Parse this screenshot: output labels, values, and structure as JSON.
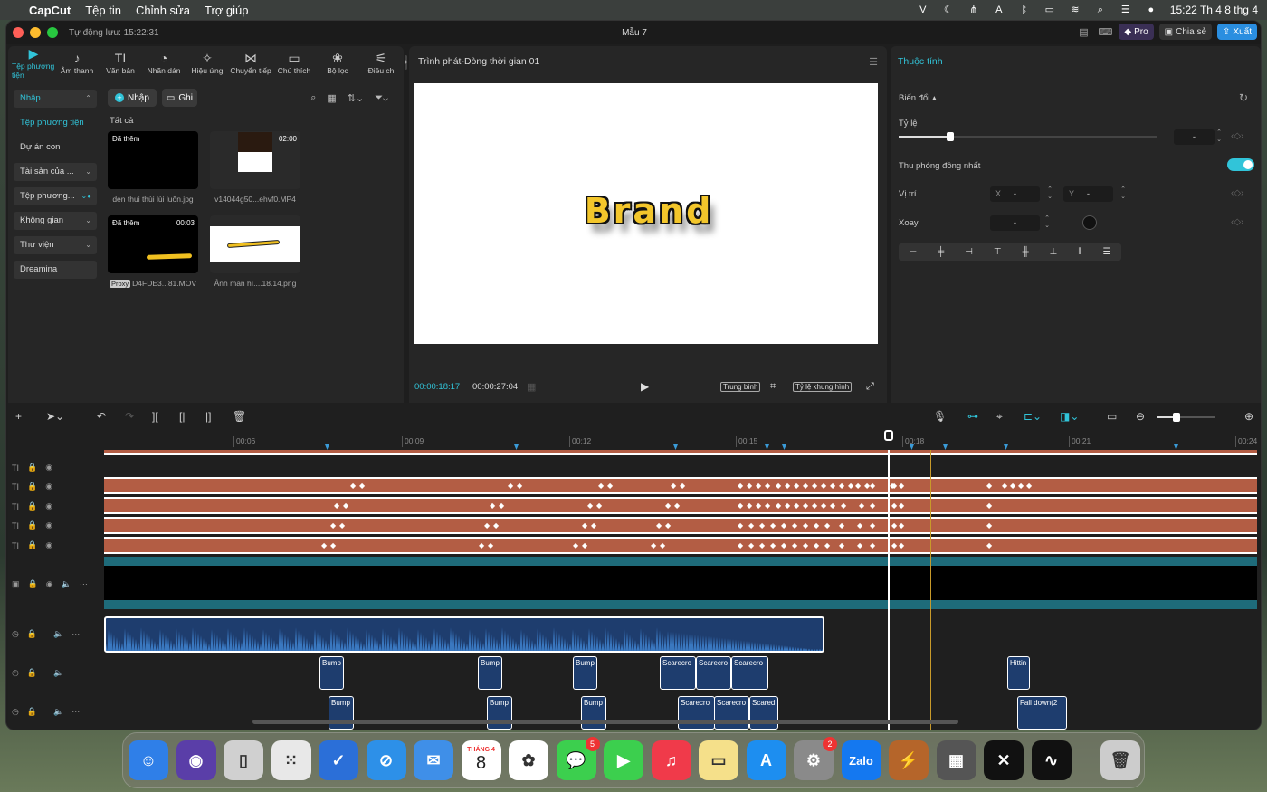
{
  "menubar": {
    "app": "CapCut",
    "items": [
      "Tệp tin",
      "Chỉnh sửa",
      "Trợ giúp"
    ],
    "clock": "15:22 Th 4 8 thg 4"
  },
  "window": {
    "autosave": "Tự động lưu: 15:22:31",
    "title": "Mẫu 7",
    "pro": "Pro",
    "share": "Chia sẻ",
    "export": "Xuất"
  },
  "tooltabs": [
    {
      "label": "Tệp phương tiện",
      "icon": "▶"
    },
    {
      "label": "Âm thanh",
      "icon": "♪"
    },
    {
      "label": "Văn bản",
      "icon": "TI"
    },
    {
      "label": "Nhãn dán",
      "icon": "◔"
    },
    {
      "label": "Hiệu ứng",
      "icon": "✧"
    },
    {
      "label": "Chuyển tiếp",
      "icon": "⋈"
    },
    {
      "label": "Chú thích",
      "icon": "▭"
    },
    {
      "label": "Bộ lọc",
      "icon": "❀"
    },
    {
      "label": "Điều ch",
      "icon": "⚟"
    }
  ],
  "sidebar": {
    "import": "Nhập",
    "media": "Tệp phương tiện",
    "subproject": "Dự án con",
    "assets": "Tài sản của ...",
    "media2": "Tệp phương...",
    "space": "Không gian",
    "library": "Thư viện",
    "dreamina": "Dreamina"
  },
  "media": {
    "import_btn": "Nhập",
    "record_btn": "Ghi",
    "filter": "Tất cả",
    "items": [
      {
        "tag": "Đã thêm",
        "duration": "",
        "name": "den thui thùi lùi luôn.jpg",
        "proxy": ""
      },
      {
        "tag": "",
        "duration": "02:00",
        "name": "v14044g50...ehvf0.MP4",
        "proxy": ""
      },
      {
        "tag": "Đã thêm",
        "duration": "00:03",
        "name": "D4FDE3...81.MOV",
        "proxy": "Proxy"
      },
      {
        "tag": "",
        "duration": "",
        "name": "Ảnh màn hì....18.14.png",
        "proxy": ""
      }
    ]
  },
  "player": {
    "title": "Trình phát-Dòng thời gian 01",
    "brand_text": "Brand",
    "current": "00:00:18:17",
    "total": "00:00:27:04",
    "quality": "Trung bình",
    "ratio": "Tỷ lệ khung hình"
  },
  "props": {
    "title": "Thuộc tính",
    "transform": "Biến đổi",
    "scale": "Tỷ lệ",
    "scale_value": "-",
    "uniform": "Thu phóng đồng nhất",
    "position": "Vị trí",
    "x_label": "X",
    "x_value": "-",
    "y_label": "Y",
    "y_value": "-",
    "rotate": "Xoay",
    "rotate_value": "-",
    "scale_level": 0.2
  },
  "timeline": {
    "ruler": [
      "00:06",
      "00:09",
      "00:12",
      "00:15",
      "00:18",
      "00:21",
      "00:24"
    ],
    "sfx_row1": [
      "Bump",
      "Bump",
      "Bump",
      "Scarecro",
      "Scarecro",
      "Scarecro",
      "Hittin"
    ],
    "sfx_row2": [
      "Bump",
      "Bump",
      "Bump",
      "Scarecro",
      "Scarecro",
      "Scared",
      "Fall down(2"
    ]
  },
  "dock": {
    "calendar_month": "THÁNG 4",
    "calendar_day": "8",
    "messages_badge": "5",
    "settings_badge": "2",
    "zalo": "Zalo"
  }
}
